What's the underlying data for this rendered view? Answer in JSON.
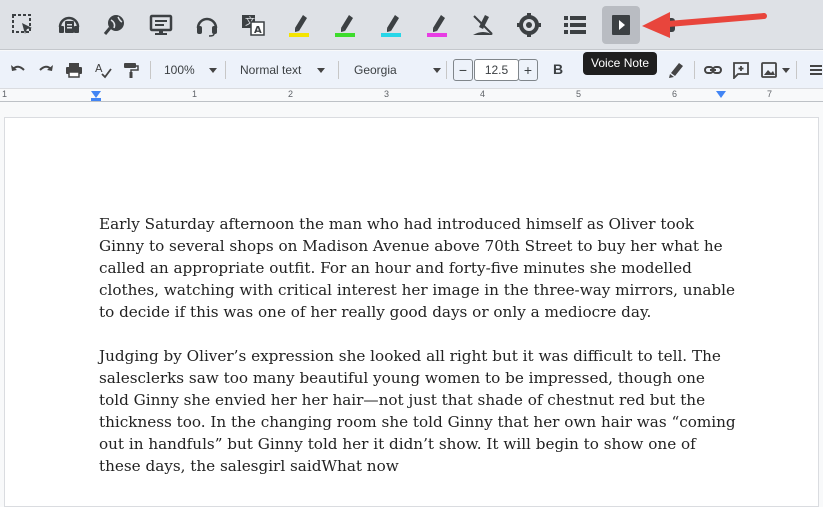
{
  "extension_toolbar": {
    "buttons": [
      {
        "name": "select-area-icon"
      },
      {
        "name": "speak-icon"
      },
      {
        "name": "web-search-icon"
      },
      {
        "name": "screen-icon"
      },
      {
        "name": "headphones-icon"
      },
      {
        "name": "translate-icon"
      },
      {
        "name": "highlight-yellow-icon",
        "color": "#f4e400"
      },
      {
        "name": "highlight-green-icon",
        "color": "#3ddc2c"
      },
      {
        "name": "highlight-cyan-icon",
        "color": "#27d6e8"
      },
      {
        "name": "highlight-magenta-icon",
        "color": "#e83ce4"
      },
      {
        "name": "clear-highlights-icon"
      },
      {
        "name": "settings-gear-icon"
      },
      {
        "name": "list-icon"
      },
      {
        "name": "voice-note-icon"
      }
    ],
    "tooltip": "Voice Note"
  },
  "docs_toolbar": {
    "zoom": "100%",
    "style": "Normal text",
    "font": "Georgia",
    "font_size": "12.5",
    "minus": "−",
    "plus": "+",
    "bold": "B"
  },
  "ruler": {
    "numbers": [
      "1",
      "1",
      "2",
      "3",
      "4",
      "5",
      "6",
      "7"
    ]
  },
  "document": {
    "paragraphs": [
      "Early Saturday afternoon the man who had introduced himself as Oliver took Ginny to several shops on Madison Avenue above 70th Street to buy her what he called an appropriate outfit. For an hour and forty-five minutes she modelled clothes, watching with critical interest her image in the three-way mirrors, unable to decide if this was one of her really good days or only a mediocre day.",
      "Judging by Oliver’s expression she looked all right but it was difficult to tell. The salesclerks saw too many beautiful young women to be impressed, though one told Ginny she envied her her hair—not just that shade of chestnut red but the thickness too. In the changing room she told Ginny that her own hair was “coming out in handfuls” but Ginny told her it didn’t show. It will begin to show one of these days, the salesgirl saidWhat now"
    ]
  },
  "colors": {
    "arrow": "#e8453c",
    "accent": "#4285f4"
  }
}
